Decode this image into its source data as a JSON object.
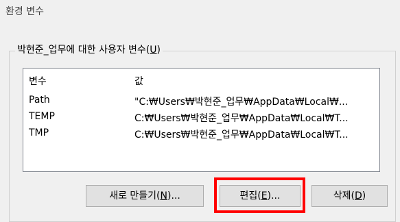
{
  "window": {
    "title": "환경 변수"
  },
  "user_vars_group": {
    "label_prefix": "박현준_업무에 대한 사용자 변수(",
    "label_hotkey": "U",
    "label_suffix": ")"
  },
  "list": {
    "columns": [
      "변수",
      "값"
    ],
    "rows": [
      {
        "name": "Path",
        "value": "\"C:₩Users₩박현준_업무₩AppData₩Local₩..."
      },
      {
        "name": "TEMP",
        "value": "C:₩Users₩박현준_업무₩AppData₩Local₩T..."
      },
      {
        "name": "TMP",
        "value": "C:₩Users₩박현준_업무₩AppData₩Local₩T..."
      }
    ]
  },
  "buttons": {
    "new": {
      "prefix": "새로 만들기(",
      "hotkey": "N",
      "suffix": ")..."
    },
    "edit": {
      "prefix": "편집(",
      "hotkey": "E",
      "suffix": ")..."
    },
    "delete": {
      "prefix": "삭제(",
      "hotkey": "D",
      "suffix": ")"
    }
  },
  "highlight_color": "#ff0000"
}
